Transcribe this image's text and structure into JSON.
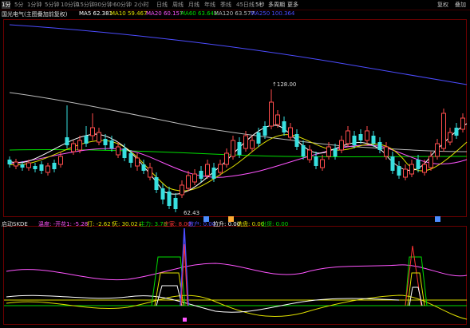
{
  "toolbar": {
    "periods": [
      "1分",
      "5分",
      "1分钟",
      "5分钟",
      "10分钟",
      "15分钟",
      "30分钟",
      "60分钟",
      "2小时",
      "日线",
      "周线",
      "月线",
      "年线",
      "季线",
      "45日线",
      "5秒",
      "多周期",
      "更多"
    ],
    "active_index": 0,
    "right_buttons": [
      "复权",
      "叠加"
    ]
  },
  "legend": {
    "title": "国光电气(主图叠加前复权)",
    "items": [
      {
        "label": "MA5 62.381",
        "color": "#ffffff"
      },
      {
        "label": "MA10 59.467",
        "color": "#e0e000"
      },
      {
        "label": "MA20 60.157",
        "color": "#ff55ff"
      },
      {
        "label": "MA60 63.641",
        "color": "#00dd00"
      },
      {
        "label": "MA120 63.577",
        "color": "#bbbbbb"
      },
      {
        "label": "MA250 100.364",
        "color": "#4c4cff"
      }
    ]
  },
  "price_labels": {
    "high": "128.00",
    "low": "62.43"
  },
  "indicator": {
    "title": "启动SKDE",
    "items": [
      {
        "label": "温度: -开花1: -5.28",
        "color": "#ff55ff"
      },
      {
        "label": "打: -2.62↑",
        "color": "#e0e000"
      },
      {
        "label": "天: 30.02↓",
        "color": "#e0e000"
      },
      {
        "label": "主力: 3.78",
        "color": "#00dd00"
      },
      {
        "label": "庄家: 8.00",
        "color": "#ff3333"
      },
      {
        "label": "散户: 0.00",
        "color": "#4c4cff"
      },
      {
        "label": "拉升: 0.00",
        "color": "#ffffff"
      },
      {
        "label": "洗盘: 0.00",
        "color": "#e0e000"
      },
      {
        "label": "出货: 0.00",
        "color": "#00dd00"
      }
    ]
  },
  "colors": {
    "up": "#ff4d4d",
    "down": "#38e0e0",
    "ma5": "#ffffff",
    "ma10": "#e0e000",
    "ma20": "#ff55ff",
    "ma60": "#00dd00",
    "ma120": "#bbbbbb",
    "ma250": "#4c4cff"
  }
}
